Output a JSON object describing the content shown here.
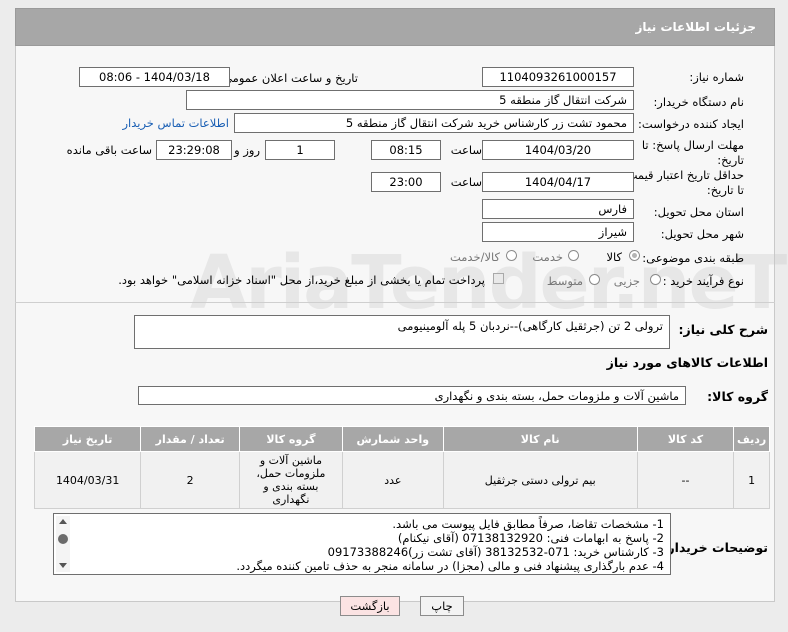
{
  "header": {
    "title": "جزئیات اطلاعات نیاز"
  },
  "form": {
    "need_number_label": "شماره نیاز:",
    "need_number": "1104093261000157",
    "announce_label": "تاریخ و ساعت اعلان عمومی:",
    "announce_value": "1404/03/18 - 08:06",
    "buyer_org_label": "نام دستگاه خریدار:",
    "buyer_org": "شرکت انتقال گاز منطقه 5",
    "requester_label": "ایجاد کننده درخواست:",
    "requester": "محمود تشت زر کارشناس خرید شرکت انتقال گاز منطقه 5",
    "contact_link": "اطلاعات تماس خریدار",
    "deadline_label": "مهلت ارسال پاسخ: تا تاریخ:",
    "deadline_date": "1404/03/20",
    "time_label": "ساعت",
    "deadline_time": "08:15",
    "days_value": "1",
    "days_label": "روز و",
    "remaining_time": "23:29:08",
    "remaining_label": "ساعت باقی مانده",
    "price_valid_label": "حداقل تاریخ اعتبار قیمت: تا تاریخ:",
    "price_valid_date": "1404/04/17",
    "price_valid_time": "23:00",
    "province_label": "استان محل تحویل:",
    "province": "فارس",
    "city_label": "شهر محل تحویل:",
    "city": "شیراز",
    "category_label": "طبقه بندی موضوعی:",
    "category_options": [
      "کالا",
      "خدمت",
      "کالا/خدمت"
    ],
    "process_label": "نوع فرآیند خرید :",
    "process_options": [
      "جزیی",
      "متوسط"
    ],
    "payment_note": "پرداخت تمام یا بخشی از مبلغ خرید،از محل \"اسناد خزانه اسلامی\" خواهد بود."
  },
  "summary": {
    "label": "شرح کلی نیاز:",
    "value": "ترولی 2 تن (جرثقیل کارگاهی)--نردبان 5 پله آلومینیومی"
  },
  "goods": {
    "section_title": "اطلاعات کالاهای مورد نیاز",
    "group_label": "گروه کالا:",
    "group_value": "ماشین آلات و ملزومات حمل، بسته بندی و نگهداری",
    "columns": [
      "ردیف",
      "کد کالا",
      "نام کالا",
      "واحد شمارش",
      "گروه کالا",
      "تعداد / مقدار",
      "تاریخ نیاز"
    ],
    "rows": [
      {
        "row": "1",
        "code": "--",
        "name": "بیم ترولی دستی جرثقیل",
        "unit": "عدد",
        "group": "ماشین آلات و ملزومات حمل، بسته بندی و نگهداری",
        "qty": "2",
        "date": "1404/03/31"
      }
    ]
  },
  "notes": {
    "label": "توضیحات خریدار:",
    "lines": [
      "1-  مشخصات تقاضا، صرفاً مطابق فایل پیوست می باشد.",
      "2- پاسخ به ابهامات فنی: 07138132920 (آقای نیکنام)",
      "3- کارشناس خرید: 071-38132532 (آقای تشت زر)09173388246",
      "4- عدم بارگذاری پیشنهاد فنی و مالی (مجزا) در سامانه منجر به حذف تامین کننده میگردد."
    ]
  },
  "buttons": {
    "print": "چاپ",
    "back": "بازگشت"
  },
  "watermark": "AriaTender.neT"
}
